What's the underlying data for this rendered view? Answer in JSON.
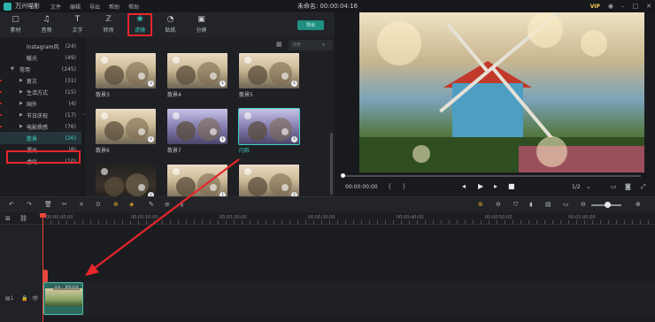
{
  "app": {
    "name": "万兴喵影",
    "doc_title": "未命名: 00:00:04:16",
    "vip_badge": "VIP"
  },
  "menu": [
    "文件",
    "编辑",
    "导出",
    "帮助",
    "帮助"
  ],
  "toolbar": {
    "tabs": [
      {
        "label": "素材",
        "icon": "media-icon"
      },
      {
        "label": "音频",
        "icon": "music-icon"
      },
      {
        "label": "文字",
        "icon": "text-icon"
      },
      {
        "label": "转场",
        "icon": "transition-icon"
      },
      {
        "label": "滤镜",
        "icon": "filter-icon",
        "active": true
      },
      {
        "label": "贴纸",
        "icon": "sticker-icon"
      },
      {
        "label": "分屏",
        "icon": "split-screen-icon"
      }
    ],
    "export_label": "导出"
  },
  "categories": [
    {
      "name": "Instagram风",
      "count": "(24)",
      "indent": 1
    },
    {
      "name": "暖光",
      "count": "(49)",
      "indent": 1
    },
    {
      "name": "常用",
      "count": "(245)",
      "indent": 0,
      "expanded": true
    },
    {
      "name": "复古",
      "count": "(31)",
      "indent": 2
    },
    {
      "name": "生活方式",
      "count": "(15)",
      "indent": 2
    },
    {
      "name": "国外",
      "count": "(4)",
      "indent": 2
    },
    {
      "name": "节日庆祝",
      "count": "(17)",
      "indent": 2
    },
    {
      "name": "电影质感",
      "count": "(76)",
      "indent": 2
    },
    {
      "name": "散景",
      "count": "(26)",
      "indent": 1,
      "selected": true
    },
    {
      "name": "漏光",
      "count": "(8)",
      "indent": 1
    },
    {
      "name": "虚化",
      "count": "(10)",
      "indent": 1
    }
  ],
  "search": {
    "placeholder": "搜索"
  },
  "thumbnails": [
    {
      "name": "散景3"
    },
    {
      "name": "散景4"
    },
    {
      "name": "散景5"
    },
    {
      "name": "散景6"
    },
    {
      "name": "散景7"
    },
    {
      "name": "闪烁",
      "selected": true
    },
    {
      "name": ""
    },
    {
      "name": ""
    },
    {
      "name": ""
    }
  ],
  "player": {
    "timecode": "00:00:00:00",
    "ratio": "1/2",
    "progress": 0
  },
  "ruler": {
    "labels": [
      "00:00:00:00",
      "00:00:10:00",
      "00:00:20:00",
      "00:00:30:00",
      "00:00:40:00",
      "00:00:50:00",
      "00:01:00:00"
    ]
  },
  "timeline": {
    "clip_label": "风车 | 漂亮花园"
  },
  "colors": {
    "accent": "#3dd0c4",
    "highlight": "#e8262b",
    "playhead": "#e8453c"
  }
}
